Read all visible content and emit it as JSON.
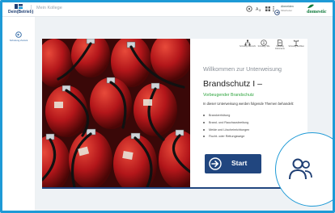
{
  "header": {
    "logo_text": "Dein(Betrieb)",
    "user_name": "Mein Kollege",
    "actions": [
      {
        "icon": "translate-icon"
      },
      {
        "icon": "grid-icon"
      },
      {
        "icon": "help-icon"
      },
      {
        "icon": "more-icon"
      }
    ],
    "logout_label": "Abmelden",
    "logout_sub": "Mitarbeiter",
    "brand_text": "domestic"
  },
  "sidebar": {
    "items": [
      {
        "label": "Schulung Zurück",
        "icon": "back-icon"
      }
    ]
  },
  "toolbar": {
    "items": [
      {
        "label": "Schulung Übersicht",
        "icon": "sitemap-icon"
      },
      {
        "label": "Schulung Hilfe",
        "icon": "info-icon"
      },
      {
        "label": "Schulung Dokumente",
        "icon": "document-icon"
      },
      {
        "label": "Schulung Zertifikat",
        "icon": "certificate-icon"
      }
    ]
  },
  "course": {
    "welcome": "Willkommen zur Unterweisung",
    "title": "Brandschutz I –",
    "subtitle": "Vorbeugender Brandschutz",
    "intro": "In dieser Unterweisung werden folgende Themen behandelt:",
    "topics": [
      "Brandverhütung",
      "Brand- und Rauchausbreitung",
      "Melde und Löscheinrichtungen",
      "Flucht- oder Rettungswege"
    ],
    "start_label": "Start"
  },
  "colors": {
    "frame": "#1e9ad6",
    "primary": "#21467f",
    "subtitle_green": "#2ea43e",
    "brand_green": "#0f7a3c"
  },
  "help": {
    "icon": "users-help-icon"
  }
}
